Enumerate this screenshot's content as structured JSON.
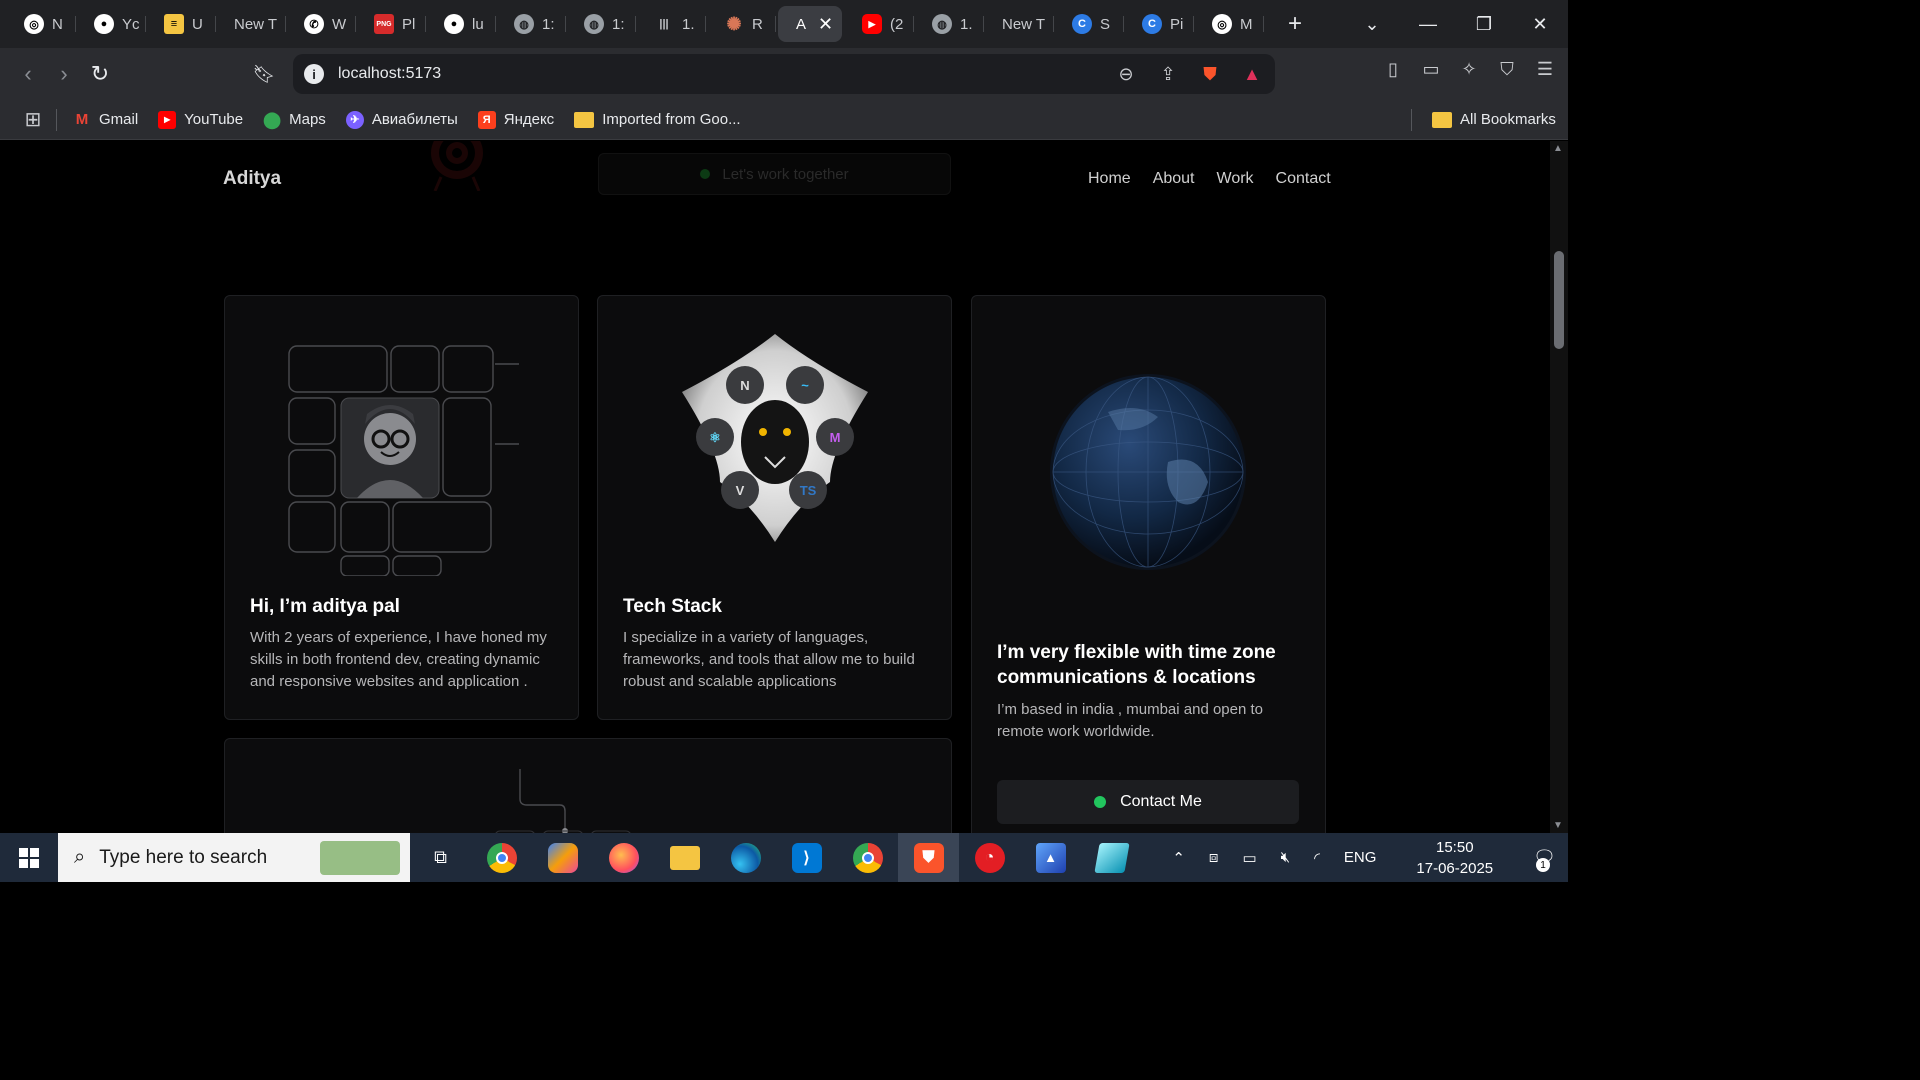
{
  "browser": {
    "tabs": [
      {
        "label": "N",
        "icon": "openai-icon"
      },
      {
        "label": "Yc",
        "icon": "github-icon"
      },
      {
        "label": "U",
        "icon": "ui-icon"
      },
      {
        "label": "New T",
        "icon": ""
      },
      {
        "label": "W",
        "icon": "whatsapp-icon"
      },
      {
        "label": "Pl",
        "icon": "pngsvg-icon"
      },
      {
        "label": "lu",
        "icon": "github-icon"
      },
      {
        "label": "1:",
        "icon": "globe-icon"
      },
      {
        "label": "1:",
        "icon": "globe-icon"
      },
      {
        "label": "1.",
        "icon": "bars-icon"
      },
      {
        "label": "R",
        "icon": "claude-icon"
      },
      {
        "label": "A",
        "icon": "",
        "active": true
      },
      {
        "label": "(2",
        "icon": "youtube-icon"
      },
      {
        "label": "1.",
        "icon": "globe-icon"
      },
      {
        "label": "New T",
        "icon": ""
      },
      {
        "label": "S",
        "icon": "canva-icon"
      },
      {
        "label": "Pi",
        "icon": "canva-icon"
      },
      {
        "label": "M",
        "icon": "openai-icon"
      }
    ],
    "new_tab": "+",
    "url": "localhost:5173",
    "bookmarks": [
      {
        "label": "Gmail",
        "icon": "gmail-icon",
        "color": "#ea4335"
      },
      {
        "label": "YouTube",
        "icon": "youtube-icon",
        "color": "#ff0000"
      },
      {
        "label": "Maps",
        "icon": "maps-icon",
        "color": "#34a853"
      },
      {
        "label": "Авиабилеты",
        "icon": "aviasales-icon",
        "color": "#7b61ff"
      },
      {
        "label": "Яндекс",
        "icon": "yandex-icon",
        "color": "#fc3f1d"
      },
      {
        "label": "Imported from Goo...",
        "icon": "folder-icon",
        "color": "#f4c542"
      }
    ],
    "all_bookmarks": "All Bookmarks"
  },
  "site": {
    "brand": "Aditya",
    "nav": [
      "Home",
      "About",
      "Work",
      "Contact"
    ],
    "pill_text": "Let's work together",
    "cards": {
      "intro": {
        "title": "Hi, I’m aditya pal",
        "body": "With 2 years of experience, I have honed my skills in both frontend dev, creating dynamic and responsive websites and application ."
      },
      "tech": {
        "title": "Tech Stack",
        "body": "I specialize in a variety of languages, frameworks, and tools that allow me to build robust and scalable applications",
        "badges": [
          "N",
          "~",
          "⚛",
          "M",
          "V",
          "TS"
        ]
      },
      "location": {
        "title": "I’m very flexible with time zone communications & locations",
        "body": "I’m based in india , mumbai and open to remote work worldwide.",
        "button": "Contact Me"
      }
    }
  },
  "taskbar": {
    "search_placeholder": "Type here to search",
    "language": "ENG",
    "time": "15:50",
    "date": "17-06-2025",
    "notifications": "1"
  },
  "colors": {
    "accent_green": "#22c55e",
    "page_bg": "#000000",
    "card_bg": "#0c0c0d"
  }
}
